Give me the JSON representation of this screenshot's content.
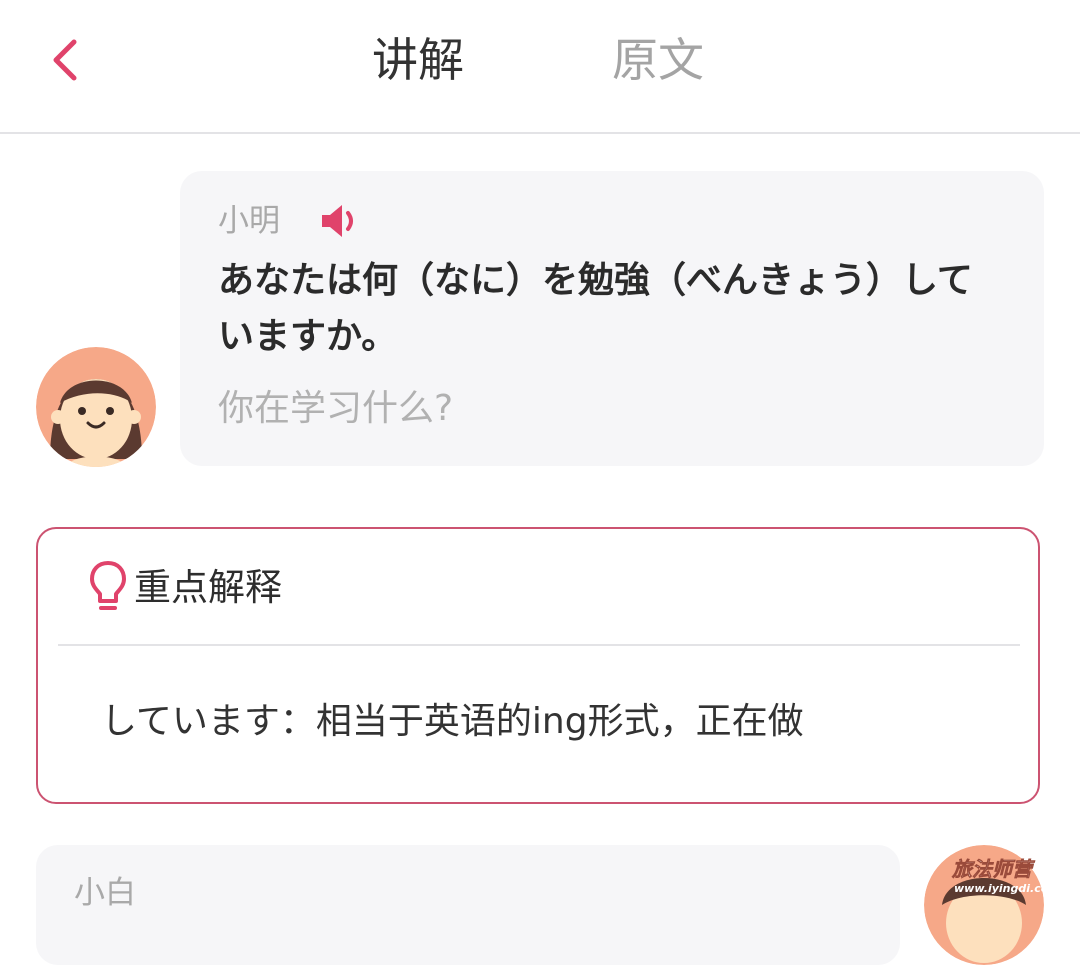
{
  "header": {
    "tabs": [
      {
        "label": "讲解",
        "active": true
      },
      {
        "label": "原文",
        "active": false
      }
    ]
  },
  "dialogue": [
    {
      "speaker": "小明",
      "japanese": "あなたは何（なに）を勉強（べんきょう）していますか。",
      "translation": "你在学习什么?"
    },
    {
      "speaker": "小白"
    }
  ],
  "key_point": {
    "title": "重点解释",
    "content": "しています：相当于英语的ing形式，正在做"
  },
  "watermark": {
    "line1": "旅法师营",
    "line2": "www.iyingdi.com"
  },
  "colors": {
    "accent": "#e0436b",
    "card_border": "#cc5371",
    "bubble_bg": "#f6f6f8"
  }
}
